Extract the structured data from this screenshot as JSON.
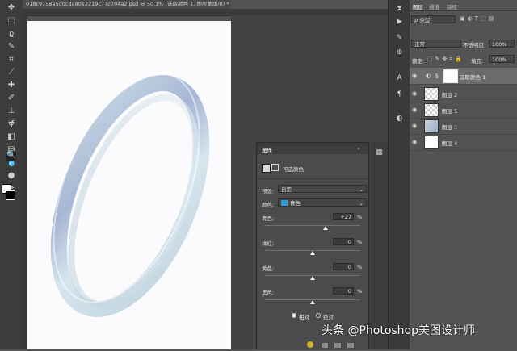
{
  "document": {
    "tab_title": "018c9158a5d0cda8012219c77c704a2.psd @ 50.1% (选取颜色 1, 图层蒙版/8) *"
  },
  "layers_panel": {
    "tabs": [
      "图层",
      "通道",
      "路径"
    ],
    "filter_kind": "ρ 类型",
    "blend_mode": "正常",
    "opacity_label": "不透明度:",
    "opacity_value": "100%",
    "lock_label": "锁定:",
    "fill_label": "填充:",
    "fill_value": "100%",
    "layers": [
      {
        "name": "选取颜色 1",
        "selected": true
      },
      {
        "name": "图层 2",
        "selected": false
      },
      {
        "name": "图层 5",
        "selected": false
      },
      {
        "name": "图层 1",
        "selected": false
      },
      {
        "name": "图层 4",
        "selected": false
      }
    ]
  },
  "properties_panel": {
    "header": "属性",
    "type_label": "可选颜色",
    "preset_label": "预设:",
    "preset_value": "自定",
    "colors_label": "颜色:",
    "colors_value": "青色",
    "colors_swatch": "#2e9bd8",
    "sliders": [
      {
        "label": "青色:",
        "value": "+27",
        "unit": "%",
        "level": 0.635
      },
      {
        "label": "洋红:",
        "value": "0",
        "unit": "%",
        "level": 0.5
      },
      {
        "label": "黄色:",
        "value": "0",
        "unit": "%",
        "level": 0.5
      },
      {
        "label": "黑色:",
        "value": "0",
        "unit": "%",
        "level": 0.5
      }
    ],
    "method_relative": "相对",
    "method_absolute": "绝对",
    "method_selected": "相对"
  },
  "watermark": "头条 @Photoshop美图设计师",
  "icons": {
    "tools": [
      "move-icon",
      "marquee-icon",
      "lasso-icon",
      "quick-select-icon",
      "crop-icon",
      "eyedropper-icon",
      "healing-icon",
      "brush-icon",
      "stamp-icon",
      "history-brush-icon",
      "eraser-icon",
      "gradient-icon",
      "blur-icon",
      "dodge-icon",
      "pen-icon",
      "type-icon",
      "path-select-icon",
      "shape-icon",
      "hand-icon",
      "zoom-icon"
    ]
  }
}
